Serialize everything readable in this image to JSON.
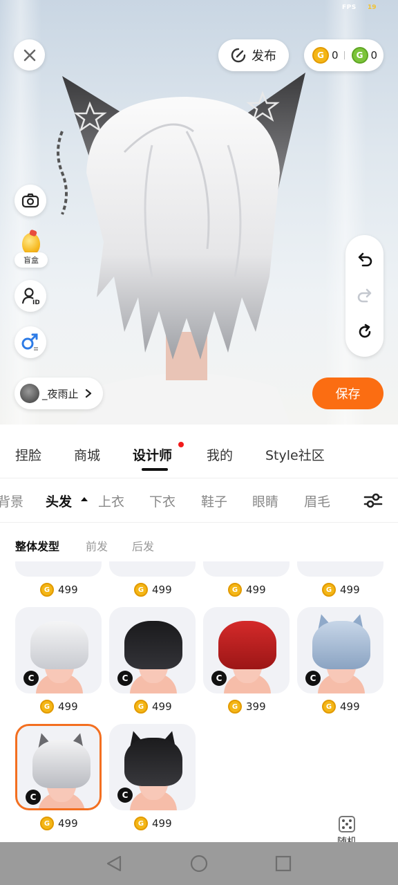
{
  "status": {
    "fps_label": "FPS",
    "fps_value": "19"
  },
  "preview": {
    "publish_label": "发布",
    "currency": {
      "gold": "0",
      "green": "0",
      "gold_symbol": "G",
      "green_symbol": "G"
    },
    "blindbox_label": "盲盒",
    "user_name": "_夜雨止",
    "save_label": "保存"
  },
  "main_tabs": [
    {
      "label": "捏脸"
    },
    {
      "label": "商城"
    },
    {
      "label": "设计师",
      "active": true,
      "has_dot": true
    },
    {
      "label": "我的"
    },
    {
      "label": "Style社区"
    }
  ],
  "sub_tabs": [
    {
      "label": "背景"
    },
    {
      "label": "头发",
      "active": true
    },
    {
      "label": "上衣"
    },
    {
      "label": "下衣"
    },
    {
      "label": "鞋子"
    },
    {
      "label": "眼睛"
    },
    {
      "label": "眉毛"
    }
  ],
  "style_tabs": [
    {
      "label": "整体发型",
      "active": true
    },
    {
      "label": "前发"
    },
    {
      "label": "后发"
    }
  ],
  "items": {
    "row0_prices": [
      "499",
      "499",
      "499",
      "499"
    ],
    "row1": [
      {
        "price": "499",
        "hair": "white-messy"
      },
      {
        "price": "499",
        "hair": "black-messy"
      },
      {
        "price": "399",
        "hair": "red-bun"
      },
      {
        "price": "499",
        "hair": "blue-cat-ears"
      }
    ],
    "row2": [
      {
        "price": "499",
        "hair": "white-cat-ears",
        "selected": true
      },
      {
        "price": "499",
        "hair": "black-cat-ears"
      }
    ],
    "badge_letter": "C",
    "coin_symbol": "G"
  },
  "random_label": "随机",
  "colors": {
    "accent": "#fb6d12",
    "coin_gold": "#f4b616",
    "coin_green": "#7cc43a",
    "notification": "#f21b1b"
  }
}
